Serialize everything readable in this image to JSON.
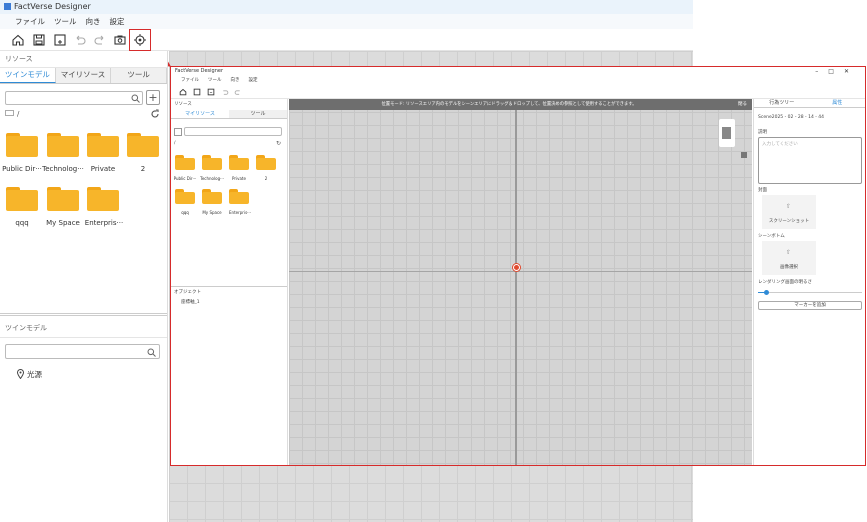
{
  "app": {
    "title": "FactVerse Designer"
  },
  "menu": [
    "ファイル",
    "ツール",
    "向き",
    "設定"
  ],
  "left_panel": {
    "header": "リソース",
    "tabs": [
      "ツインモデル",
      "マイリソース",
      "ツール"
    ],
    "path": "/",
    "folders": [
      "Public Dir···",
      "Technolog···",
      "Private",
      "2",
      "qqq",
      "My Space",
      "Enterpris···"
    ]
  },
  "twin_panel": {
    "header": "ツインモデル",
    "items": [
      "光源"
    ]
  },
  "inner": {
    "title": "FactVerse Designer",
    "menu": [
      "ファイル",
      "ツール",
      "向き",
      "設定"
    ],
    "left": {
      "header": "リソース",
      "tabs": [
        "マイリソース",
        "ツール"
      ],
      "path": "/",
      "folders": [
        "Public Dir···",
        "Technolog···",
        "Private",
        "2",
        "qqq",
        "My Space",
        "Enterpris···"
      ],
      "object_header": "オブジェクト",
      "objects": [
        "座標軸_1"
      ]
    },
    "banner": {
      "text": "位置モード: リソースエリア内のモデルをシーンエリアにドラッグ＆ドロップして、位置決めの参照として使用することができます。",
      "close_label": "閉る"
    },
    "right": {
      "tabs": [
        "行為ツリー",
        "属性"
      ],
      "scene_name": "Scene2025 - 02 - 28 - 14 - 44",
      "desc_label": "説明",
      "desc_placeholder": "入力してください",
      "cover_label": "封面",
      "screenshot_label": "スクリーンショット",
      "thumb_label": "シーンボトム",
      "select_image_label": "画像選択",
      "render_label": "レンダリング画面の明るさ",
      "brightness": 0.08,
      "marker_button": "マーカーを追加"
    }
  },
  "colors": {
    "accent": "#2f8bd6",
    "folder": "#f7b52a",
    "highlight": "#d62b2b"
  }
}
